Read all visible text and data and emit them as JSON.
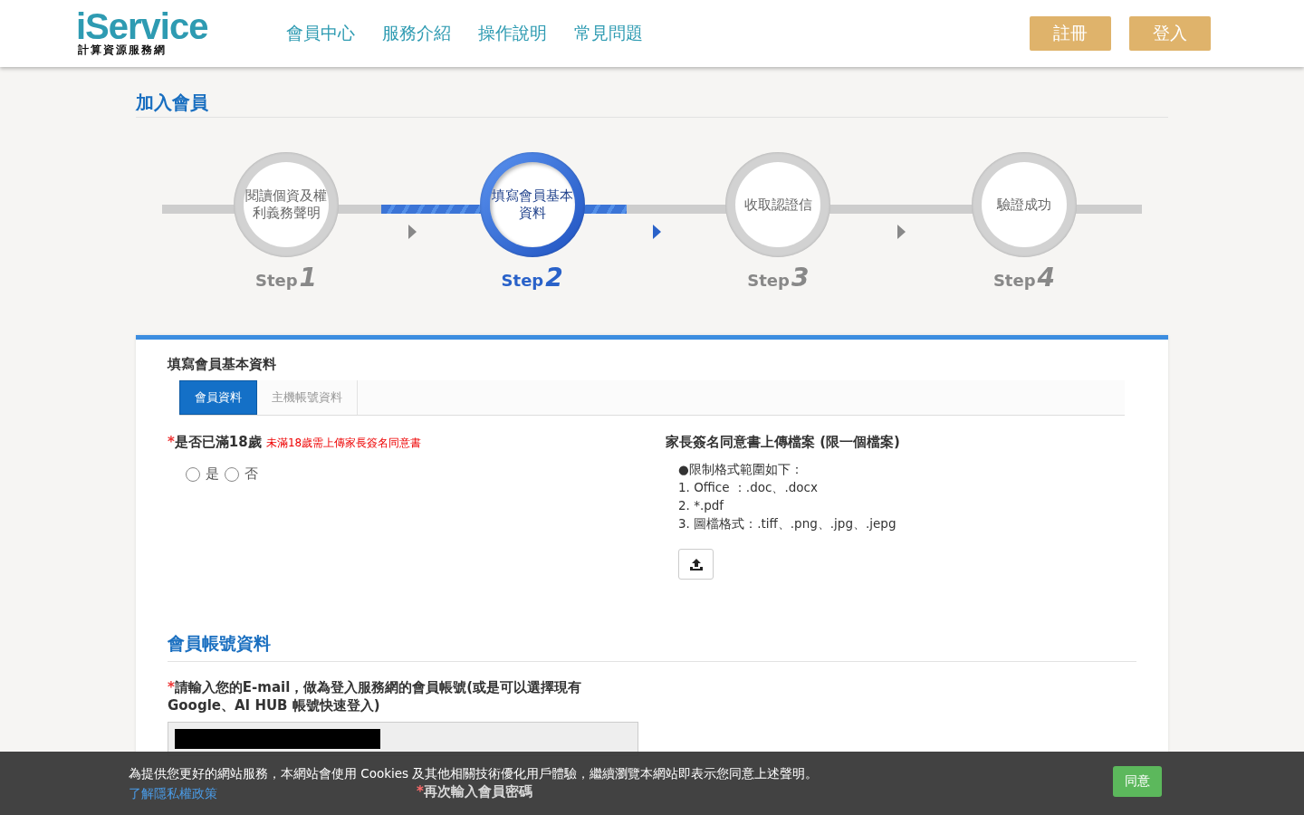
{
  "header": {
    "logo": "iService",
    "logo_subtitle": "計算資源服務網",
    "nav": [
      "會員中心",
      "服務介紹",
      "操作說明",
      "常見問題"
    ],
    "buttons": [
      "註冊",
      "登入"
    ]
  },
  "page_title": "加入會員",
  "steps": [
    {
      "label": "閱讀個資及權利義務聲明",
      "step_word": "Step",
      "number": "1",
      "selected": false
    },
    {
      "label": "填寫會員基本資料",
      "step_word": "Step",
      "number": "2",
      "selected": true
    },
    {
      "label": "收取認證信",
      "step_word": "Step",
      "number": "3",
      "selected": false
    },
    {
      "label": "驗證成功",
      "step_word": "Step",
      "number": "4",
      "selected": false
    }
  ],
  "form": {
    "title": "填寫會員基本資料",
    "tabs": [
      {
        "label": "會員資料",
        "selected": true
      },
      {
        "label": "主機帳號資料",
        "selected": false
      }
    ],
    "age_question": {
      "required_mark": "*",
      "label": "是否已滿18歲",
      "note": "未滿18歲需上傳家長簽名同意書",
      "options": [
        {
          "label": "是",
          "checked": false
        },
        {
          "label": "否",
          "checked": false
        }
      ]
    },
    "upload": {
      "title": "家長簽名同意書上傳檔案 (限一個檔案)",
      "rules": [
        "●限制格式範圍如下：",
        "1. Office ：.doc、.docx",
        "2. *.pdf",
        "3. 圖檔格式：.tiff、.png、.jpg、.jepg"
      ]
    },
    "account_section": {
      "title": "會員帳號資料",
      "email_label": {
        "required_mark": "*",
        "text": "請輸入您的E-mail，做為登入服務網的會員帳號(或是可以選擇現有Google、AI HUB 帳號快速登入)"
      },
      "confirm_password_label": {
        "required_mark": "*",
        "text": "再次輸入會員密碼"
      }
    }
  },
  "cookie_bar": {
    "message": "為提供您更好的網站服務，本網站會使用 Cookies 及其他相關技術優化用戶體驗，繼續瀏覽本網站即表示您同意上述聲明。",
    "link": "了解隱私權政策",
    "button": "同意"
  }
}
